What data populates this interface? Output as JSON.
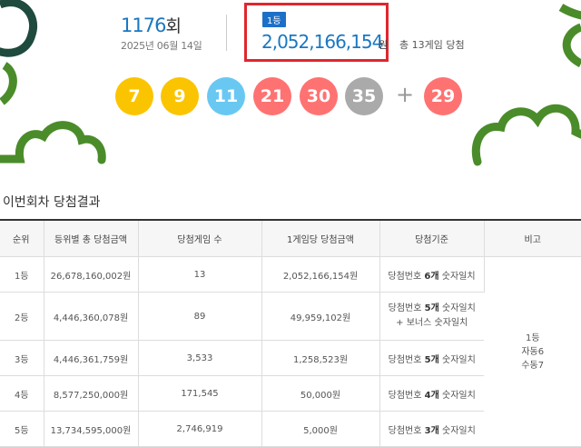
{
  "header": {
    "round_number": "1176",
    "round_unit": "회",
    "draw_date": "2025년 06월 14일",
    "first_prize_badge": "1등",
    "first_prize_amount": "2,052,166,154",
    "first_prize_unit": "원",
    "winner_games": "총 13게임 당첨"
  },
  "balls": [
    {
      "number": "7",
      "color": "#fbc400"
    },
    {
      "number": "9",
      "color": "#fbc400"
    },
    {
      "number": "11",
      "color": "#69c8f2"
    },
    {
      "number": "21",
      "color": "#ff7272"
    },
    {
      "number": "30",
      "color": "#ff7272"
    },
    {
      "number": "35",
      "color": "#aaaaaa"
    }
  ],
  "plus_sign": "+",
  "bonus_ball": {
    "number": "29",
    "color": "#ff7272"
  },
  "section_title": "이번회차 당첨결과",
  "table": {
    "headers": [
      "순위",
      "등위별 총 당첨금액",
      "당첨게임 수",
      "1게임당 당첨금액",
      "당첨기준",
      "비고"
    ],
    "rows": [
      {
        "rank": "1등",
        "total": "26,678,160,002원",
        "games": "13",
        "per_game": "2,052,166,154원",
        "criteria_prefix": "당첨번호",
        "criteria_count": "6개",
        "criteria_suffix": "숫자일치",
        "criteria_extra": ""
      },
      {
        "rank": "2등",
        "total": "4,446,360,078원",
        "games": "89",
        "per_game": "49,959,102원",
        "criteria_prefix": "당첨번호",
        "criteria_count": "5개",
        "criteria_suffix": "숫자일치",
        "criteria_extra": "+ 보너스 숫자일치"
      },
      {
        "rank": "3등",
        "total": "4,446,361,759원",
        "games": "3,533",
        "per_game": "1,258,523원",
        "criteria_prefix": "당첨번호",
        "criteria_count": "5개",
        "criteria_suffix": "숫자일치",
        "criteria_extra": ""
      },
      {
        "rank": "4등",
        "total": "8,577,250,000원",
        "games": "171,545",
        "per_game": "50,000원",
        "criteria_prefix": "당첨번호",
        "criteria_count": "4개",
        "criteria_suffix": "숫자일치",
        "criteria_extra": ""
      },
      {
        "rank": "5등",
        "total": "13,734,595,000원",
        "games": "2,746,919",
        "per_game": "5,000원",
        "criteria_prefix": "당첨번호",
        "criteria_count": "3개",
        "criteria_suffix": "숫자일치",
        "criteria_extra": ""
      }
    ],
    "note_lines": [
      "1등",
      "자동6",
      "수동7"
    ]
  },
  "colors": {
    "accent": "#1a78c2",
    "highlight_border": "#e0262e",
    "decor_green": "#4a8c2a",
    "decor_dark": "#1f4a3e"
  }
}
